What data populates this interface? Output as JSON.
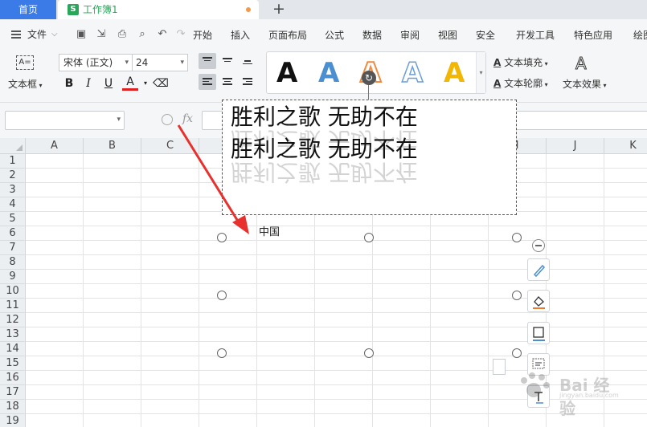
{
  "tabs": {
    "home": "首页",
    "doc_icon": "S",
    "doc_title": "工作簿1",
    "add": "+"
  },
  "menu": {
    "file": "文件",
    "items": [
      "开始",
      "插入",
      "页面布局",
      "公式",
      "数据",
      "审阅",
      "视图",
      "安全",
      "开发工具",
      "特色应用",
      "绘图"
    ]
  },
  "ribbon": {
    "textbox": "文本框",
    "textbox_glyph": "A=",
    "font_name": "宋体 (正文)",
    "font_size": "24",
    "bold": "B",
    "italic": "I",
    "underline": "U",
    "font_color": "A",
    "style_letter": "A",
    "text_fill": "文本填充",
    "text_outline": "文本轮廓",
    "text_effect": "文本效果",
    "accent_color": "#3b7be8",
    "style_colors": [
      "#111111",
      "#4a8fd1",
      "#ee8b3f",
      "#6a9fd8",
      "#f2b705"
    ]
  },
  "formula": {
    "namebox_value": "",
    "fx": "fx",
    "formula_value": ""
  },
  "sheet": {
    "columns": [
      "A",
      "B",
      "C",
      "D",
      "E",
      "F",
      "G",
      "H",
      "I",
      "J",
      "K"
    ],
    "rows": [
      "1",
      "2",
      "3",
      "4",
      "5",
      "6",
      "7",
      "8",
      "9",
      "10",
      "11",
      "12",
      "13",
      "14",
      "15",
      "16",
      "17",
      "18",
      "19"
    ],
    "cell_text": "中国"
  },
  "shape": {
    "line1": "胜利之歌 无助不在",
    "line2": "胜利之歌 无助不在",
    "rotate_glyph": "↻"
  },
  "side_toolbar": [
    "pen-icon",
    "fill-icon",
    "border-icon",
    "textbox-icon",
    "text-icon"
  ],
  "watermark": {
    "text": "Bai 经验",
    "sub": "jingyan.baidu.com"
  },
  "annotation_arrow_color": "#e8302c"
}
